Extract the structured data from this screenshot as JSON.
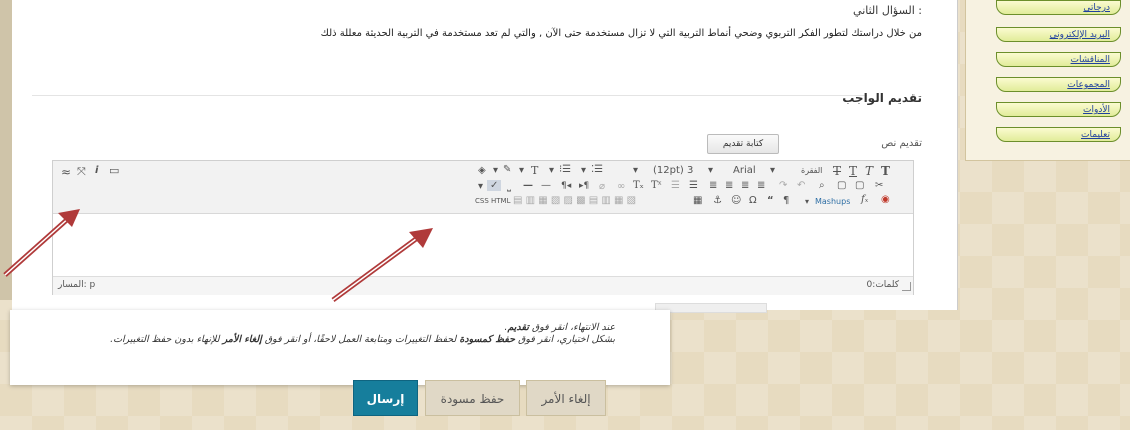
{
  "question": {
    "label": "السؤال الثاني :",
    "text": "من خلال دراستك لتطور الفكر التربوي وضحي أنماط التربية التي لا تزال مستخدمة حتى الآن , والتي لم تعد مستخدمة في التربية الحديثة معللة ذلك"
  },
  "submission": {
    "section_title": "تقديم الواجب",
    "text_label": "تقديم نص",
    "write_button": "كتابة تقديم"
  },
  "editor": {
    "toolbar": {
      "paragraph_label": "الفقرة",
      "font_family": "Arial",
      "font_size": "(12pt) 3",
      "mashups_label": "Mashups",
      "html_label": "HTML",
      "css_label": "CSS"
    },
    "path_label": "المسار: p",
    "word_count": "كلمات:0"
  },
  "sidebar": {
    "items": [
      {
        "label": "درجاتي",
        "icon": "grades-link"
      },
      {
        "label": "البريد الإلكتروني",
        "icon": "email-link"
      },
      {
        "label": "المناقشات",
        "icon": "discussions-link"
      },
      {
        "label": "المجموعات",
        "icon": "groups-link"
      },
      {
        "label": "الأدوات",
        "icon": "tools-link"
      },
      {
        "label": "تعليمات",
        "icon": "help-link"
      }
    ]
  },
  "notice": {
    "line1_prefix": "عند الانتهاء، انقر فوق",
    "line1_bold": "تقديم",
    "line2_prefix": "بشكل اختياري، انقر فوق",
    "line2_bold1": "حفظ كمسودة",
    "line2_mid": "لحفظ التغييرات ومتابعة العمل لاحقًا، أو انقر فوق",
    "line2_bold2": "إلغاء الأمر",
    "line2_suffix": "للإنهاء بدون حفظ التغييرات."
  },
  "footer": {
    "cancel_label": "إلغاء الأمر",
    "draft_label": "حفظ مسودة",
    "send_label": "إرسال"
  },
  "colors": {
    "send_button": "#167e9c",
    "sidebar_button_border": "#6c8f2b",
    "arrow": "#b03a3a"
  }
}
